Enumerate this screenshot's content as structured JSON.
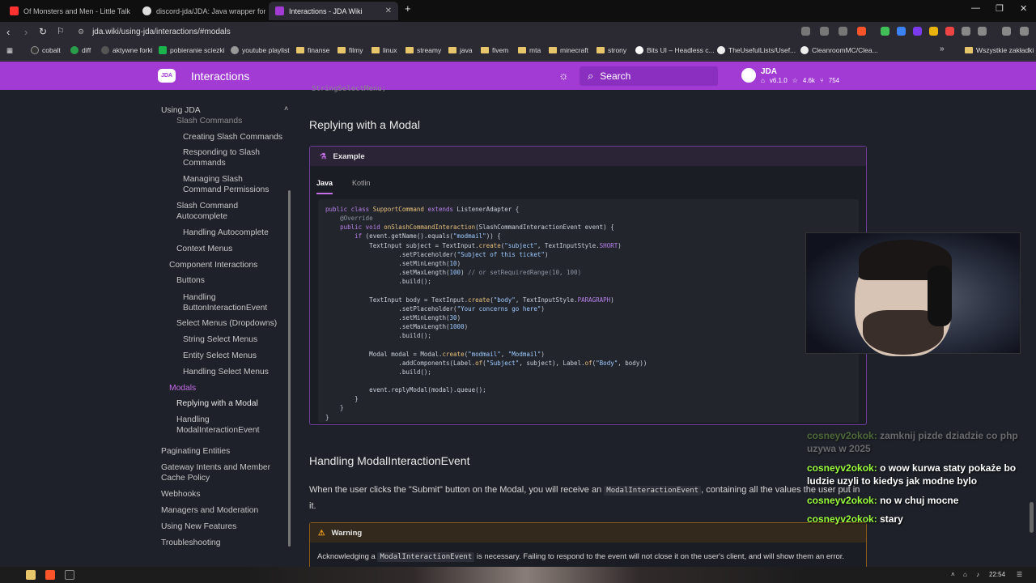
{
  "browser": {
    "tabs": [
      {
        "label": "Of Monsters and Men - Little Talk",
        "fav": "#ff3131"
      },
      {
        "label": "discord-jda/JDA: Java wrapper for the",
        "fav": "#dddddd"
      },
      {
        "label": "Interactions - JDA Wiki",
        "fav": "#a13bd4"
      }
    ],
    "url": "jda.wiki/using-jda/interactions/#modals",
    "bookmarks": [
      "cobalt",
      "diff",
      "aktywne forki",
      "pobieranie sciezki",
      "youtube playlist",
      "finanse",
      "filmy",
      "linux",
      "streamy",
      "java",
      "fivem",
      "mta",
      "minecraft",
      "strony",
      "Bits UI – Headless c...",
      "TheUsefulLists/Usef...",
      "CleanroomMC/Clea...",
      "»",
      "Wszystkie zakładki"
    ]
  },
  "site": {
    "logo": "JDA",
    "title": "Interactions",
    "search_placeholder": "Search",
    "repo": {
      "name": "JDA",
      "version": "v6.1.0",
      "stars": "4.6k",
      "forks": "754"
    }
  },
  "sidebar": {
    "items": [
      {
        "label": "Using JDA",
        "level": 0
      },
      {
        "label": "Slash Commands",
        "level": 1
      },
      {
        "label": "Creating Slash Commands",
        "level": 2
      },
      {
        "label": "Responding to Slash",
        "level": 2
      },
      {
        "label": "Commands",
        "level": 2
      },
      {
        "label": "Managing Slash",
        "level": 2
      },
      {
        "label": "Command Permissions",
        "level": 2
      },
      {
        "label": "Slash Command",
        "level": 1
      },
      {
        "label": "Autocomplete",
        "level": 1
      },
      {
        "label": "Handling Autocomplete",
        "level": 2
      },
      {
        "label": "Context Menus",
        "level": 1
      },
      {
        "label": "Component Interactions",
        "level": 0.5
      },
      {
        "label": "Buttons",
        "level": 1
      },
      {
        "label": "Handling",
        "level": 2
      },
      {
        "label": "ButtonInteractionEvent",
        "level": 2
      },
      {
        "label": "Select Menus (Dropdowns)",
        "level": 1
      },
      {
        "label": "String Select Menus",
        "level": 2
      },
      {
        "label": "Entity Select Menus",
        "level": 2
      },
      {
        "label": "Handling Select Menus",
        "level": 2
      },
      {
        "label": "Modals",
        "level": 0.5
      },
      {
        "label": "Replying with a Modal",
        "level": 1
      },
      {
        "label": "Handling",
        "level": 1
      },
      {
        "label": "ModalInteractionEvent",
        "level": 1
      },
      {
        "label": "Paginating Entities",
        "level": 0
      },
      {
        "label": "Gateway Intents and Member",
        "level": 0
      },
      {
        "label": "Cache Policy",
        "level": 0
      },
      {
        "label": "Webhooks",
        "level": 0
      },
      {
        "label": "Managers and Moderation",
        "level": 0
      },
      {
        "label": "Using New Features",
        "level": 0
      },
      {
        "label": "Troubleshooting",
        "level": 0
      }
    ]
  },
  "content": {
    "prev_code_tail": "StringSelectMenu;",
    "heading1": "Replying with a Modal",
    "example_title": "Example",
    "tab_java": "Java",
    "tab_kotlin": "Kotlin",
    "heading2": "Handling ModalInteractionEvent",
    "para_before": "When the user clicks the \"Submit\" button on the Modal, you will receive an",
    "para_code": "ModalInteractionEvent",
    "para_after": ", containing all the values the user put in it.",
    "warning_title": "Warning",
    "warning_before": "Acknowledging a",
    "warning_code": "ModalInteractionEvent",
    "warning_after": "is necessary. Failing to respond to the event will not close it on the user's client, and will show them an error."
  },
  "chat": [
    {
      "user": "cosneyv2okok:",
      "text": "zamknij pizde dziadzie co php uzywa w 2025",
      "faded": true
    },
    {
      "user": "cosneyv2okok:",
      "text": "o wow kurwa staty pokaże bo ludzie uzyli to kiedys jak modne bylo",
      "faded": false
    },
    {
      "user": "cosneyv2okok:",
      "text": "no w chuj mocne",
      "faded": false
    },
    {
      "user": "cosneyv2okok:",
      "text": "stary",
      "faded": false
    }
  ],
  "taskbar": {
    "time": "22:54"
  }
}
